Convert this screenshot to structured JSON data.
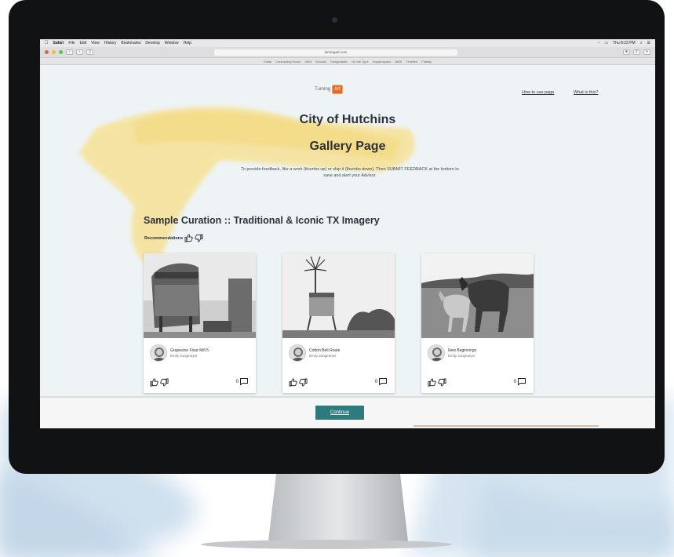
{
  "browser": {
    "menu_items": [
      "Safari",
      "File",
      "Edit",
      "View",
      "History",
      "Bookmarks",
      "Develop",
      "Window",
      "Help"
    ],
    "clock": "Thu 8:23 PM",
    "url": "turningart.com",
    "bookmarks": [
      "Email",
      "Contracting Hours",
      "JIRA",
      "Schools",
      "Designtastic",
      "On the Type",
      "Squarespace",
      "AWS",
      "Timeline",
      "Fidelity"
    ]
  },
  "header": {
    "logo_prefix": "Turning",
    "logo_box": "Art",
    "link_how": "How to use page",
    "link_what": "What is this?"
  },
  "page": {
    "city": "City of Hutchins",
    "gallery": "Gallery Page",
    "intro": "To provide feedback, like a work (thumbs up) or skip it (thumbs down). Then SUBMIT FEEDBACK at the bottom to save and alert your Advisor.",
    "curation_title": "Sample Curation :: Traditional & Iconic TX Imagery",
    "recommendations_label": "Recommendations"
  },
  "artworks": [
    {
      "title": "Grapevine Flour Mill 5",
      "artist": "Emily Jungmeyer",
      "comments": "0"
    },
    {
      "title": "Cotton Belt Route",
      "artist": "Emily Jungmeyer",
      "comments": "0"
    },
    {
      "title": "New Beginnings",
      "artist": "Emily Jungmeyer",
      "comments": "0"
    }
  ],
  "footer": {
    "continue_label": "Continue"
  },
  "colors": {
    "accent_teal": "#2d7b7d",
    "logo_orange": "#e46a25",
    "brush_yellow": "#f5dd84",
    "bezel": "#111214"
  }
}
